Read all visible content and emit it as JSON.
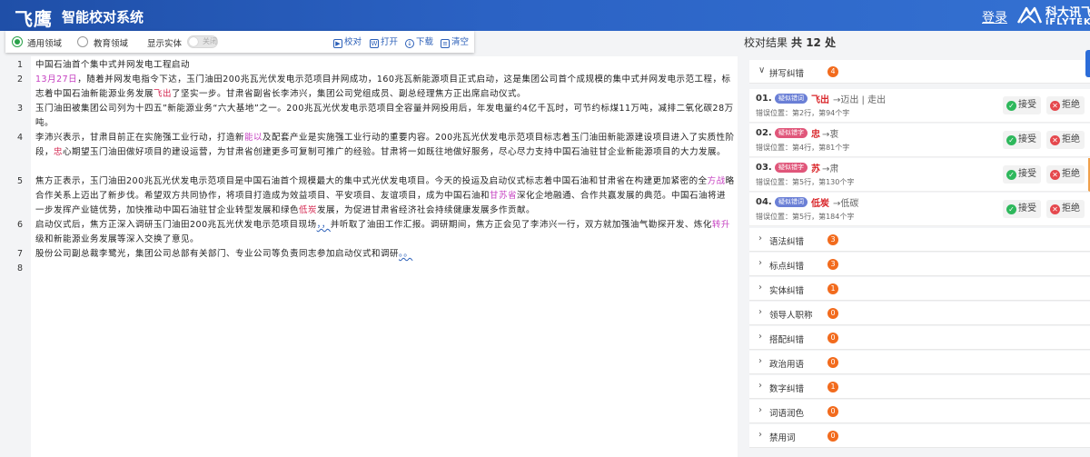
{
  "header": {
    "logo_text": "飞鹰",
    "title": "智能校对系统",
    "login": "登录",
    "brand_cn": "科大讯飞",
    "brand_en": "iFLYTEK"
  },
  "toolbar": {
    "domain_general": "通用领域",
    "domain_education": "教育领域",
    "show_entity": "显示实体",
    "toggle_text": "关闭",
    "proofread": "校对",
    "open": "打开",
    "download": "下载",
    "clear": "清空"
  },
  "editor": {
    "line_numbers": [
      "1",
      "2",
      "3",
      "4",
      "5",
      "6",
      "7",
      "8"
    ],
    "p1": "中国石油首个集中式并网发电工程启动",
    "p2a": "13月27日",
    "p2b": "，随着并网发电指令下达，玉门油田200兆瓦光伏发电示范项目并网成功，160兆瓦新能源项目正式启动，这是集团公司首个成规模的集中式并网发电示范工程，标志着中国石油新能源业务发展",
    "p2c": "飞出",
    "p2d": "了坚实一步。甘肃省副省长李沛兴，集团公司党组成员、副总经理焦方正出席启动仪式。",
    "p3": "玉门油田被集团公司列为十四五”新能源业务“六大基地”之一。200兆瓦光伏发电示范项目全容量并网投用后，年发电量约4亿千瓦时，可节约标煤11万吨，减排二氧化碳28万吨。",
    "p4a": "李沛兴表示，甘肃目前正在实施强工业行动，打造新",
    "p4b": "能以",
    "p4c": "及配套产业是实施强工业行动的重要内容。200兆瓦光伏发电示范项目标志着玉门油田新能源建设项目进入了实质性阶段，",
    "p4d": "忠",
    "p4e": "心期望玉门油田做好项目的建设运营，为甘肃省创建更多可复制可推广的经验。甘肃将一如既往地做好服务，尽心尽力支持中国石油驻甘企业新能源项目的大力发展。",
    "p5a": "焦方正表示，玉门油田200兆瓦光伏发电示范项目是中国石油首个规模最大的集中式光伏发电项目。今天的投运及启动仪式标志着中国石油和甘肃省在构建更加紧密的全",
    "p5b": "方战",
    "p5c": "略合作关系上迈出了新步伐。希望双方共同协作，将项目打造成为效益项目、平安项目、友谊项目，成为中国石油和",
    "p5d": "甘苏省",
    "p5e": "深化企地融通、合作共赢发展的典范。中国石油将进一步发挥产业链优势，加快推动中国石油驻甘企业转型发展和绿色",
    "p5f": "低炭",
    "p5g": "发展，为促进甘肃省经济社会持续健康发展多作贡献。",
    "p6a": "启动仪式后，焦方正深入调研玉门油田200兆瓦光伏发电示范项目现场",
    "p6b": "，，",
    "p6c": "并听取了油田工作汇报。调研期间，焦方正会见了李沛兴一行，双方就加强油气勘探开发、炼化",
    "p6d": "转升",
    "p6e": "级和新能源业务发展等深入交换了意见。",
    "p7a": "股份公司副总裁李鹭光，集团公司总部有关部门、专业公司等负责同志参加启动仪式和调研",
    "p7b": "。。"
  },
  "results": {
    "title": "校对结果",
    "count_text": "共 12 处",
    "groups": [
      {
        "name": "拼写纠错",
        "count": "4",
        "expanded": "∨"
      },
      {
        "name": "语法纠错",
        "count": "3",
        "expanded": "›"
      },
      {
        "name": "标点纠错",
        "count": "3",
        "expanded": "›"
      },
      {
        "name": "实体纠错",
        "count": "1",
        "expanded": "›"
      },
      {
        "name": "领导人职称",
        "count": "0",
        "expanded": "›"
      },
      {
        "name": "搭配纠错",
        "count": "0",
        "expanded": "›"
      },
      {
        "name": "政治用语",
        "count": "0",
        "expanded": "›"
      },
      {
        "name": "数字纠错",
        "count": "1",
        "expanded": "›"
      },
      {
        "name": "词语润色",
        "count": "0",
        "expanded": "›"
      },
      {
        "name": "禁用词",
        "count": "0",
        "expanded": "›"
      }
    ],
    "items": [
      {
        "no": "01.",
        "tag": "疑似错词",
        "src": "飞出",
        "fix": "→迈出 | 走出",
        "loc": "错误位置：第2行，第94个字"
      },
      {
        "no": "02.",
        "tag": "疑似错字",
        "src": "忠",
        "fix": "→衷",
        "loc": "错误位置：第4行，第81个字"
      },
      {
        "no": "03.",
        "tag": "疑似错字",
        "src": "苏",
        "fix": "→肃",
        "loc": "错误位置：第5行，第130个字"
      },
      {
        "no": "04.",
        "tag": "疑似错词",
        "src": "低炭",
        "fix": "→低碳",
        "loc": "错误位置：第5行，第184个字"
      }
    ],
    "accept": "接受",
    "reject": "拒绝"
  }
}
